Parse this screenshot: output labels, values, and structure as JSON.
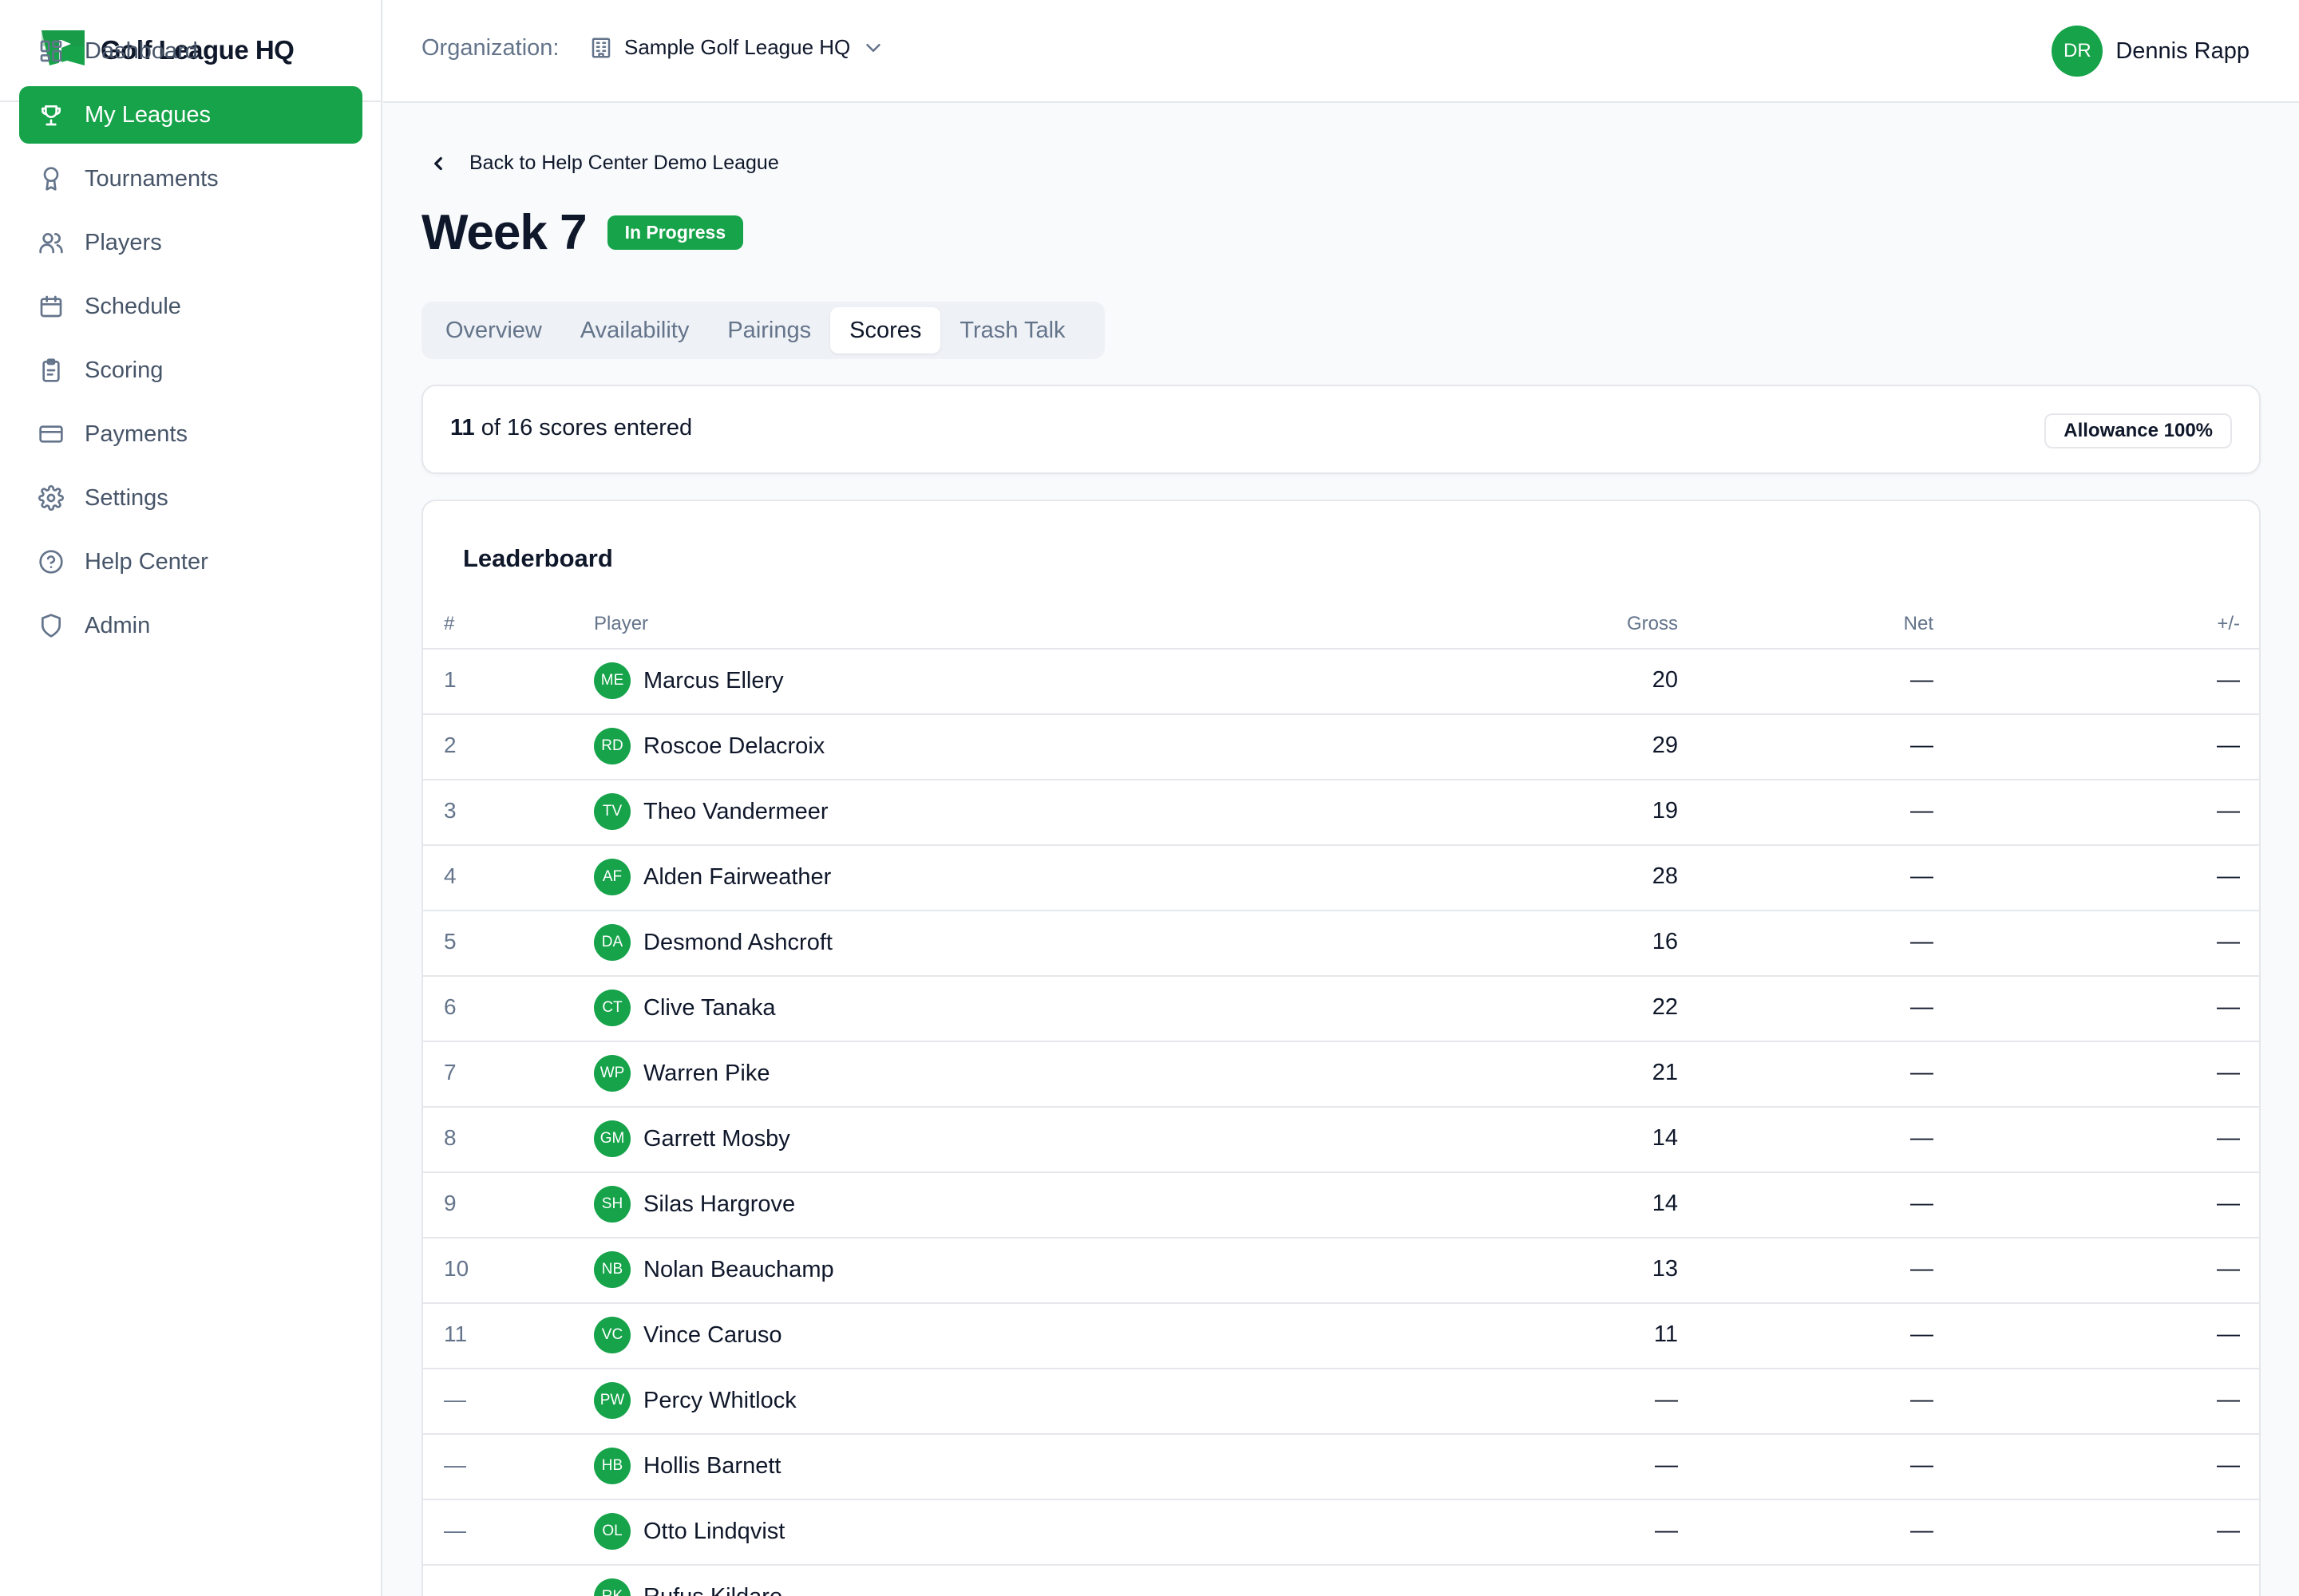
{
  "app": {
    "name": "Golf League HQ"
  },
  "nav": [
    {
      "label": "Dashboard",
      "icon": "dashboard-icon"
    },
    {
      "label": "My Leagues",
      "icon": "trophy-icon",
      "active": true
    },
    {
      "label": "Tournaments",
      "icon": "award-icon"
    },
    {
      "label": "Players",
      "icon": "users-icon"
    },
    {
      "label": "Schedule",
      "icon": "calendar-icon"
    },
    {
      "label": "Scoring",
      "icon": "clipboard-icon"
    },
    {
      "label": "Payments",
      "icon": "credit-card-icon"
    },
    {
      "label": "Settings",
      "icon": "gear-icon"
    },
    {
      "label": "Help Center",
      "icon": "help-circle-icon"
    },
    {
      "label": "Admin",
      "icon": "shield-icon"
    }
  ],
  "topbar": {
    "org_label": "Organization:",
    "org_name": "Sample Golf League HQ",
    "user_initials": "DR",
    "user_name": "Dennis Rapp"
  },
  "page": {
    "back_label": "Back to Help Center Demo League",
    "title": "Week 7",
    "status": "In Progress",
    "tabs": [
      "Overview",
      "Availability",
      "Pairings",
      "Scores",
      "Trash Talk"
    ],
    "active_tab": "Scores"
  },
  "summary": {
    "entered": "11",
    "text": "of 16 scores entered",
    "allowance": "Allowance 100%"
  },
  "leaderboard": {
    "title": "Leaderboard",
    "columns": [
      "#",
      "Player",
      "Gross",
      "Net",
      "+/-"
    ],
    "rows": [
      {
        "rank": "1",
        "initials": "ME",
        "name": "Marcus Ellery",
        "gross": "20",
        "net": "—",
        "pm": "—"
      },
      {
        "rank": "2",
        "initials": "RD",
        "name": "Roscoe Delacroix",
        "gross": "29",
        "net": "—",
        "pm": "—"
      },
      {
        "rank": "3",
        "initials": "TV",
        "name": "Theo Vandermeer",
        "gross": "19",
        "net": "—",
        "pm": "—"
      },
      {
        "rank": "4",
        "initials": "AF",
        "name": "Alden Fairweather",
        "gross": "28",
        "net": "—",
        "pm": "—"
      },
      {
        "rank": "5",
        "initials": "DA",
        "name": "Desmond Ashcroft",
        "gross": "16",
        "net": "—",
        "pm": "—"
      },
      {
        "rank": "6",
        "initials": "CT",
        "name": "Clive Tanaka",
        "gross": "22",
        "net": "—",
        "pm": "—"
      },
      {
        "rank": "7",
        "initials": "WP",
        "name": "Warren Pike",
        "gross": "21",
        "net": "—",
        "pm": "—"
      },
      {
        "rank": "8",
        "initials": "GM",
        "name": "Garrett Mosby",
        "gross": "14",
        "net": "—",
        "pm": "—"
      },
      {
        "rank": "9",
        "initials": "SH",
        "name": "Silas Hargrove",
        "gross": "14",
        "net": "—",
        "pm": "—"
      },
      {
        "rank": "10",
        "initials": "NB",
        "name": "Nolan Beauchamp",
        "gross": "13",
        "net": "—",
        "pm": "—"
      },
      {
        "rank": "11",
        "initials": "VC",
        "name": "Vince Caruso",
        "gross": "11",
        "net": "—",
        "pm": "—"
      },
      {
        "rank": "—",
        "initials": "PW",
        "name": "Percy Whitlock",
        "gross": "—",
        "net": "—",
        "pm": "—"
      },
      {
        "rank": "—",
        "initials": "HB",
        "name": "Hollis Barnett",
        "gross": "—",
        "net": "—",
        "pm": "—"
      },
      {
        "rank": "—",
        "initials": "OL",
        "name": "Otto Lindqvist",
        "gross": "—",
        "net": "—",
        "pm": "—"
      },
      {
        "rank": "—",
        "initials": "RK",
        "name": "Rufus Kildare",
        "gross": "—",
        "net": "—",
        "pm": "—"
      }
    ]
  },
  "colors": {
    "accent": "#16a34a",
    "border": "#e5e7eb",
    "muted": "#64748b"
  }
}
